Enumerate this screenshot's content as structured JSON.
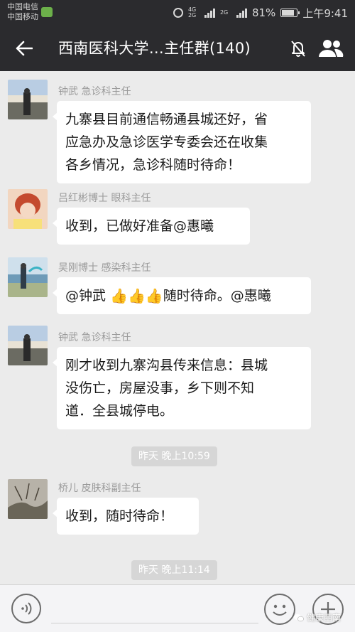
{
  "status_bar": {
    "carrier1": "中国电信",
    "carrier2": "中国移动",
    "net1": "4G",
    "net2": "2G",
    "net3": "2G",
    "battery": "81%",
    "time": "上午9:41"
  },
  "header": {
    "title": "西南医科大学…主任群(140)"
  },
  "messages": [
    {
      "sender": "钟武 急诊科主任",
      "lines": [
        "九寨县目前通信畅通县城还好，省",
        "应急办及急诊医学专委会还在收集",
        "各乡情况，急诊科随时待命！"
      ]
    },
    {
      "sender": "吕红彬博士 眼科主任",
      "lines": [
        "收到，已做好准备@惠曦"
      ]
    },
    {
      "sender": "吴刚博士 感染科主任",
      "before": "@钟武 ",
      "after": "随时待命。@惠曦"
    },
    {
      "sender": "钟武 急诊科主任",
      "lines": [
        "刚才收到九寨沟县传来信息：县城",
        "没伤亡，房屋没事，乡下则不知",
        "道．全县城停电。"
      ]
    },
    {
      "sender": "桥儿 皮肤科副主任",
      "lines": [
        "收到，随时待命！"
      ]
    }
  ],
  "timestamps": [
    "昨天 晚上10:59",
    "昨天 晚上11:14"
  ],
  "watermark": "健康西南",
  "icons": {
    "back": "back-arrow-icon",
    "mute": "mute-bell-icon",
    "members": "group-members-icon",
    "voice": "voice-icon",
    "emoji": "emoji-icon",
    "plus": "plus-icon",
    "thumbs": "thumbs-up-icon"
  },
  "colors": {
    "header_bg": "#2b2b2e",
    "chat_bg": "#ebebeb",
    "bubble_bg": "#ffffff",
    "timestamp_bg": "#d6d6d6"
  }
}
